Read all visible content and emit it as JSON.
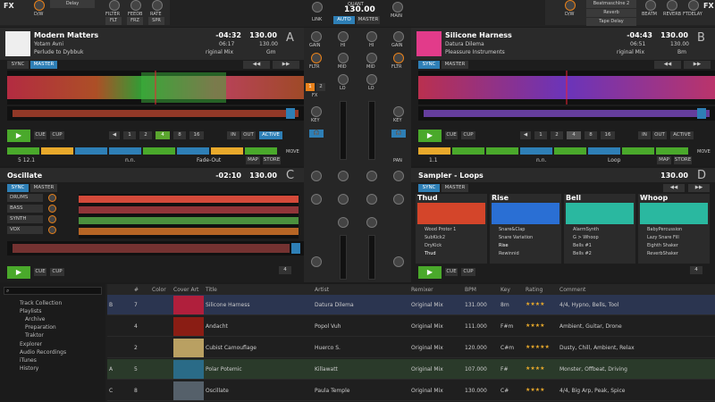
{
  "fx_left": {
    "label": "FX",
    "knob_labels": [
      "D/W",
      "FILTER",
      "FEEDB",
      "RATE"
    ],
    "effect": "Delay",
    "button_labels": [
      "",
      "FLT",
      "FRZ",
      "SPR"
    ]
  },
  "fx_right": {
    "label": "FX",
    "knob_labels": [
      "D/W",
      "BEATM",
      "REVERB",
      "FTDELAY"
    ],
    "effects": [
      "BeatmaschIne 2",
      "Reverb",
      "Tape Delay"
    ],
    "button_labels": [
      "",
      "",
      "",
      ""
    ]
  },
  "quant": {
    "label": "QUANT",
    "bpm": "130.00",
    "link": "LINK",
    "auto": "AUTO",
    "master": "MASTER",
    "main": "MAIN"
  },
  "deckA": {
    "title": "Modern Matters",
    "artist": "Yotam Avni",
    "album": "Perlude to Dybbuk",
    "remaining": "-04:32",
    "elapsed": "06:17",
    "bpm": "130.00",
    "bpm2": "130.00",
    "mix": "riginal Mix",
    "key": "Gm",
    "letter": "A",
    "sync": "SYNC",
    "master": "MASTER",
    "pos": "5 12.1",
    "nudge": "n.n.",
    "fade": "Fade-Out",
    "loops": [
      "1",
      "2",
      "4",
      "8",
      "16"
    ],
    "active_loop": "4",
    "in": "IN",
    "out": "OUT",
    "active": "ACTIVE",
    "cue": "CUE",
    "cup": "CUP",
    "map": "MAP",
    "store": "STORE",
    "move": "MOVE",
    "cues": [
      "",
      "A",
      "",
      "",
      "",
      "",
      "",
      ""
    ]
  },
  "deckB": {
    "title": "Silicone Harness",
    "artist": "Datura Dilema",
    "album": "Pleassure Instruments",
    "remaining": "-04:43",
    "elapsed": "06:51",
    "bpm": "130.00",
    "bpm2": "130.00",
    "mix": "riginal Mix",
    "key": "Bm",
    "letter": "B",
    "sync": "SYNC",
    "master": "MASTER",
    "pos": "1.1",
    "nudge": "n.n.",
    "fade": "Loop",
    "loops": [
      "1",
      "2",
      "4",
      "8",
      "16"
    ],
    "active_loop": "4",
    "in": "IN",
    "out": "OUT",
    "active": "ACTIVE",
    "cue": "CUE",
    "cup": "CUP",
    "map": "MAP",
    "store": "STORE",
    "move": "MOVE"
  },
  "deckC": {
    "title": "Oscillate",
    "remaining": "-02:10",
    "bpm": "130.00",
    "letter": "C",
    "sync": "SYNC",
    "master": "MASTER",
    "stems": [
      "DRUMS",
      "BASS",
      "SYNTH",
      "VOX"
    ],
    "cue": "CUE",
    "cup": "CUP",
    "loop": "4"
  },
  "deckD": {
    "title": "Sampler - Loops",
    "bpm": "130.00",
    "letter": "D",
    "sync": "SYNC",
    "master": "MASTER",
    "loop": "4",
    "cue": "CUE",
    "cup": "CUP",
    "slots": [
      {
        "name": "Thud",
        "items": [
          "Wood Protor 1",
          "SubKick2",
          "DryKick",
          "Thud"
        ],
        "active": 3
      },
      {
        "name": "Rise",
        "items": [
          "Snare&Clap",
          "Snare Variation",
          "Rise",
          "Rewinnid"
        ],
        "active": 2
      },
      {
        "name": "Bell",
        "items": [
          "AlarmSynth",
          "G > Whoop",
          "Bells #1",
          "Bells #2"
        ],
        "active": -1
      },
      {
        "name": "Whoop",
        "items": [
          "BabyPercussion",
          "Lazy Snare Fill",
          "Eighth Shaker",
          "ReverbShaker"
        ],
        "active": -1
      }
    ]
  },
  "mixer": {
    "labels": [
      "GAIN",
      "FLTR",
      "FX",
      "KEY",
      "PAN"
    ],
    "eq": [
      "HI",
      "MID",
      "LO"
    ],
    "fx_units": [
      "1",
      "2"
    ]
  },
  "browser": {
    "search_icon": "search-icon",
    "sidebar": [
      "Track Collection",
      "Playlists",
      "Archive",
      "Preparation",
      "Traktor",
      "Explorer",
      "Audio Recordings",
      "iTunes",
      "History"
    ],
    "columns": [
      "#",
      "Color",
      "Cover Art",
      "Title",
      "Artist",
      "Remixer",
      "BPM",
      "Key",
      "Rating",
      "Comment"
    ],
    "rows": [
      {
        "deck": "B",
        "num": "7",
        "title": "Silicone Harness",
        "artist": "Datura Dilema",
        "remixer": "Original Mix",
        "bpm": "131.000",
        "key": "8m",
        "stars": 4,
        "comment": "4/4, Hypno, Bells, Tool",
        "hl": "b",
        "cover": "#b01f3c"
      },
      {
        "deck": "",
        "num": "4",
        "title": "Andacht",
        "artist": "Popol Vuh",
        "remixer": "Original Mix",
        "bpm": "111.000",
        "key": "F#m",
        "stars": 4,
        "comment": "Ambient, Guitar, Drone",
        "hl": "",
        "cover": "#8a1d14"
      },
      {
        "deck": "",
        "num": "2",
        "title": "Cubist Camouflage",
        "artist": "Huerco S.",
        "remixer": "Original Mix",
        "bpm": "120.000",
        "key": "C#m",
        "stars": 5,
        "comment": "Dusty, Chill, Ambient, Relax",
        "hl": "",
        "cover": "#b9a062"
      },
      {
        "deck": "A",
        "num": "5",
        "title": "Polar Potemic",
        "artist": "Killawatt",
        "remixer": "Original Mix",
        "bpm": "107.000",
        "key": "F#",
        "stars": 4,
        "comment": "Monster, Offbeat, Driving",
        "hl": "a",
        "cover": "#2a6b87"
      },
      {
        "deck": "C",
        "num": "8",
        "title": "Oscillate",
        "artist": "Paula Temple",
        "remixer": "Original Mix",
        "bpm": "130.000",
        "key": "C#",
        "stars": 4,
        "comment": "4/4, Big Arp, Peak, Spice",
        "hl": "",
        "cover": "#55606a"
      }
    ]
  },
  "colors": {
    "accent": "#2e7fb6",
    "play": "#4aa92b",
    "loop_active": "#5aa52e",
    "orange": "#e8811a"
  }
}
